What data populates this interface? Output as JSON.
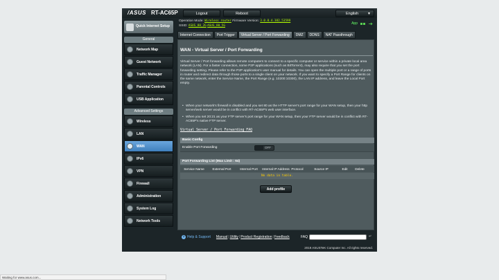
{
  "header": {
    "logo": "/ASUS",
    "model": "RT-AC65P",
    "logout_label": "Logout",
    "reboot_label": "Reboot",
    "language": "English",
    "operation_mode_label": "Operation Mode:",
    "operation_mode": "Wireless router",
    "firmware_label": "Firmware Version:",
    "firmware": "3.0.0.4.382_53599",
    "ssid_label": "SSID:",
    "ssid_1": "ASUS_80_2G",
    "ssid_2": "ASUS_80_5G",
    "app_label": "App"
  },
  "sidebar": {
    "qis_label": "Quick Internet Setup",
    "general_label": "General",
    "general_items": [
      {
        "label": "Network Map",
        "icon": "network-map-icon"
      },
      {
        "label": "Guest Network",
        "icon": "guest-network-icon"
      },
      {
        "label": "Traffic Manager",
        "icon": "traffic-manager-icon"
      },
      {
        "label": "Parental Controls",
        "icon": "parental-controls-icon"
      },
      {
        "label": "USB Application",
        "icon": "usb-icon"
      }
    ],
    "advanced_label": "Advanced Settings",
    "advanced_items": [
      {
        "label": "Wireless",
        "icon": "wireless-icon"
      },
      {
        "label": "LAN",
        "icon": "lan-icon"
      },
      {
        "label": "WAN",
        "icon": "wan-icon",
        "active": true
      },
      {
        "label": "IPv6",
        "icon": "ipv6-icon"
      },
      {
        "label": "VPN",
        "icon": "vpn-icon"
      },
      {
        "label": "Firewall",
        "icon": "firewall-icon"
      },
      {
        "label": "Administration",
        "icon": "administration-icon"
      },
      {
        "label": "System Log",
        "icon": "system-log-icon"
      },
      {
        "label": "Network Tools",
        "icon": "network-tools-icon"
      }
    ]
  },
  "tabs": [
    {
      "label": "Internet Connection"
    },
    {
      "label": "Port Trigger"
    },
    {
      "label": "Virtual Server / Port Forwarding",
      "active": true
    },
    {
      "label": "DMZ"
    },
    {
      "label": "DDNS"
    },
    {
      "label": "NAT Passthrough"
    }
  ],
  "main": {
    "title": "WAN - Virtual Server / Port Forwarding",
    "description": "Virtual Server / Port forwarding allows remote computers to connect to a specific computer or service within a private local area network (LAN). For a faster connection, some P2P applications (such as BitTorrent), may also require that you set the port forwarding setting. Please refer to the P2P application's user manual for details. You can open the multiple port or a range of ports in router and redirect data through those ports to a single client on your network. If you want to specify a Port Range for clients on the same network, enter the Service Name, the Port Range (e.g. 10200:10300), the LAN IP address, and leave the Local Port empty.",
    "bullet_1": "When your network's firewall is disabled and you set 80 as the HTTP server's port range for your WAN setup, then your http server/web server would be in conflict with RT-AC65P's web user interface.",
    "bullet_2": "When you set 20:21 as your FTP server's port range for your WAN setup, then your FTP server would be in conflict with RT-AC65P's native FTP server.",
    "faq_link": "Virtual Server / Port Forwarding FAQ",
    "basic_config_label": "Basic Config",
    "enable_pf_label": "Enable Port Forwarding",
    "toggle_state": "OFF",
    "list_label": "Port Forwarding List (Max Limit : 64)",
    "columns": [
      "Service Name",
      "External Port",
      "Internal Port",
      "Internal IP Address",
      "Protocol",
      "Source IP",
      "Edit",
      "Delete"
    ],
    "no_data": "No data in table.",
    "add_profile_label": "Add profile"
  },
  "footer": {
    "help_label": "Help & Support",
    "manual": "Manual",
    "utility": "Utility",
    "product_registration": "Product Registration",
    "feedback": "Feedback",
    "faq_label": "FAQ",
    "copyright": "2019 ASUSTeK Computer Inc. All rights reserved."
  },
  "browser_status": "Waiting for www.asus.com..."
}
